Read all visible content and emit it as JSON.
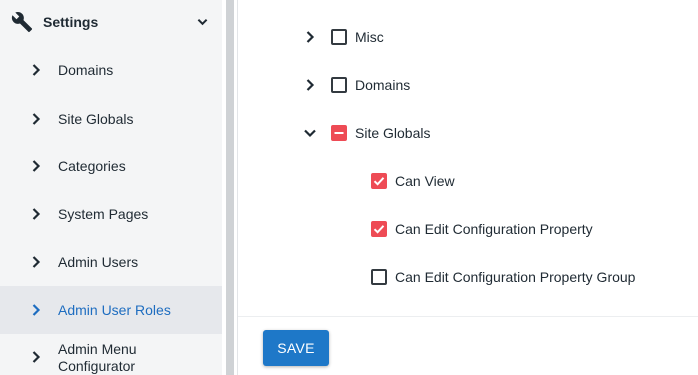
{
  "sidebar": {
    "header": {
      "title": "Settings",
      "icon": "wrench-icon"
    },
    "items": [
      {
        "label": "Domains"
      },
      {
        "label": "Site Globals"
      },
      {
        "label": "Categories"
      },
      {
        "label": "System Pages"
      },
      {
        "label": "Admin Users"
      },
      {
        "label": "Admin User Roles",
        "active": true
      },
      {
        "label": "Admin Menu Configurator"
      }
    ]
  },
  "permissions": {
    "groups": [
      {
        "label": "Misc",
        "expanded": false,
        "state": "unchecked"
      },
      {
        "label": "Domains",
        "expanded": false,
        "state": "unchecked"
      },
      {
        "label": "Site Globals",
        "expanded": true,
        "state": "indeterminate",
        "children": [
          {
            "label": "Can View",
            "state": "checked"
          },
          {
            "label": "Can Edit Configuration Property",
            "state": "checked"
          },
          {
            "label": "Can Edit Configuration Property Group",
            "state": "unchecked"
          }
        ]
      }
    ]
  },
  "footer": {
    "save_label": "SAVE"
  },
  "colors": {
    "accent": "#1e78c8",
    "active_text": "#1e6dc0",
    "checkbox_checked": "#ee4b55"
  }
}
